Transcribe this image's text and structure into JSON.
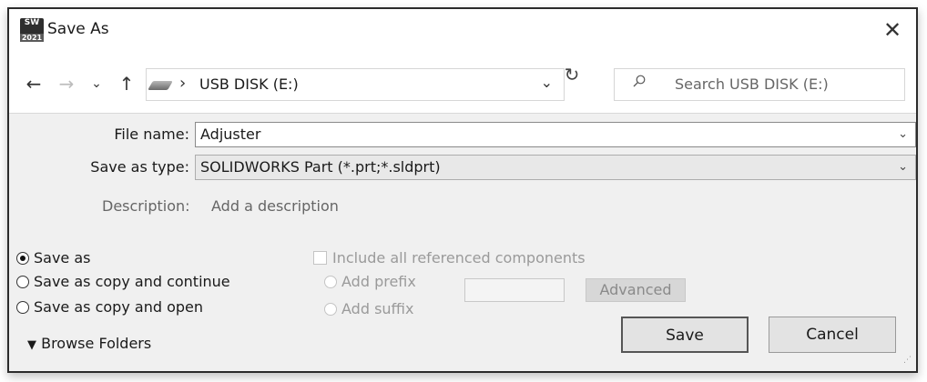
{
  "window": {
    "title": "Save As",
    "app_icon_text": "SW",
    "app_icon_year": "2021"
  },
  "nav": {
    "back_icon": "back-arrow-icon",
    "forward_icon": "forward-arrow-icon",
    "recent_icon": "chevron-down-icon",
    "up_icon": "up-arrow-icon",
    "address": "USB DISK (E:)",
    "search_placeholder": "Search USB DISK (E:)"
  },
  "form": {
    "file_name_label": "File name:",
    "file_name_value": "Adjuster",
    "save_type_label": "Save as type:",
    "save_type_value": "SOLIDWORKS Part (*.prt;*.sldprt)",
    "description_label": "Description:",
    "description_value": "Add a description"
  },
  "options": {
    "save_modes": [
      {
        "label": "Save as",
        "checked": true
      },
      {
        "label": "Save as copy and continue",
        "checked": false
      },
      {
        "label": "Save as copy and open",
        "checked": false
      }
    ],
    "include_components": "Include all referenced components",
    "add_prefix": "Add prefix",
    "add_suffix": "Add suffix",
    "advanced": "Advanced"
  },
  "buttons": {
    "save": "Save",
    "cancel": "Cancel",
    "browse_folders": "Browse Folders"
  }
}
